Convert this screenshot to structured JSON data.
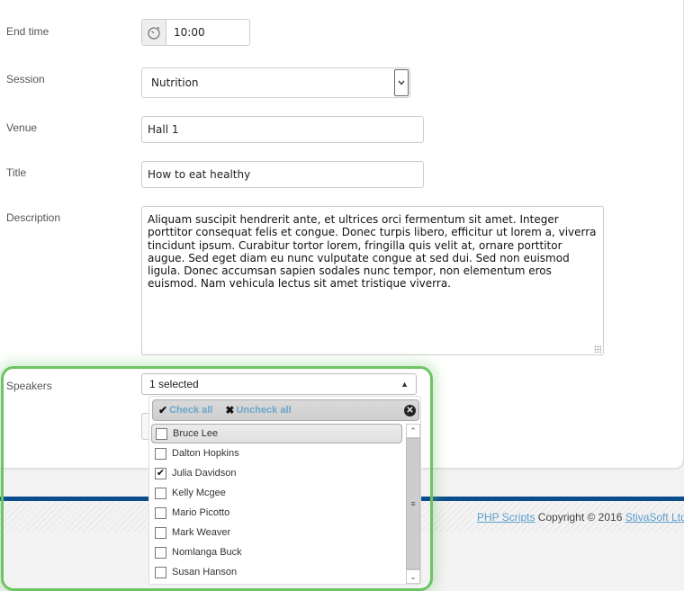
{
  "form": {
    "end_time": {
      "label": "End time",
      "value": "10:00",
      "icon": "clock-icon"
    },
    "session": {
      "label": "Session",
      "value": "Nutrition"
    },
    "venue": {
      "label": "Venue",
      "value": "Hall 1"
    },
    "title": {
      "label": "Title",
      "value": "How to eat healthy"
    },
    "description": {
      "label": "Description",
      "value": "Aliquam suscipit hendrerit ante, et ultrices orci fermentum sit amet. Integer porttitor consequat felis et congue. Donec turpis libero, efficitur ut lorem a, viverra tincidunt ipsum. Curabitur tortor lorem, fringilla quis velit at, ornare porttitor augue. Sed eget diam eu nunc vulputate congue at sed dui. Sed non euismod ligula. Donec accumsan sapien sodales nunc tempor, non elementum eros euismod. Nam vehicula lectus sit amet tristique viverra."
    },
    "speakers": {
      "label": "Speakers",
      "summary": "1 selected",
      "check_all": "Check all",
      "uncheck_all": "Uncheck all",
      "options": [
        {
          "label": "Bruce Lee",
          "checked": false
        },
        {
          "label": "Dalton Hopkins",
          "checked": false
        },
        {
          "label": "Julia Davidson",
          "checked": true
        },
        {
          "label": "Kelly Mcgee",
          "checked": false
        },
        {
          "label": "Mario Picotto",
          "checked": false
        },
        {
          "label": "Mark Weaver",
          "checked": false
        },
        {
          "label": "Nomlanga Buck",
          "checked": false
        },
        {
          "label": "Susan Hanson",
          "checked": false
        }
      ]
    }
  },
  "footer": {
    "link1": "PHP Scripts",
    "copyright": " Copyright © 2016 ",
    "link2": "StivaSoft Ltd"
  },
  "colors": {
    "accent_link": "#5a9fc8",
    "footer_band": "#0b4c8c",
    "highlight": "#6cc464"
  }
}
